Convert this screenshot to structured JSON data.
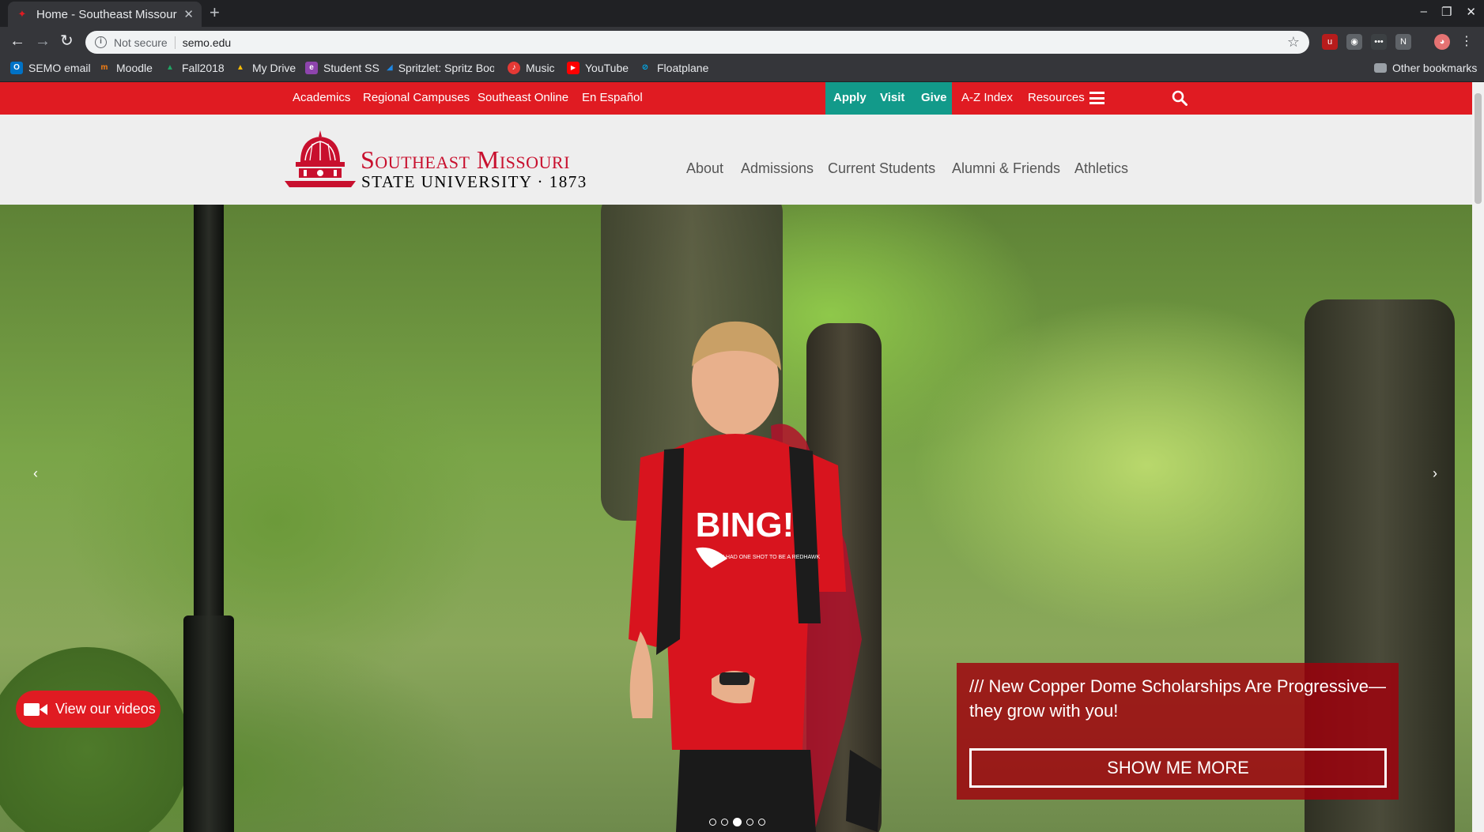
{
  "browser": {
    "tab_title": "Home - Southeast Missouri St",
    "new_tab": "+",
    "address": {
      "security_label": "Not secure",
      "url": "semo.edu"
    },
    "bookmarks": [
      {
        "label": "SEMO email",
        "icon": "outlook-icon",
        "color": "#0072c6"
      },
      {
        "label": "Moodle",
        "icon": "moodle-icon",
        "color": "#f98012"
      },
      {
        "label": "Fall2018",
        "icon": "drive-icon",
        "color": "#1fa463"
      },
      {
        "label": "My Drive",
        "icon": "drive-icon",
        "color": "#1fa463"
      },
      {
        "label": "Student SS",
        "icon": "e-icon",
        "color": "#8e44ad"
      },
      {
        "label": "Spritzlet: Spritz Boo",
        "icon": "spritz-icon",
        "color": "#1e88e5"
      },
      {
        "label": "Music",
        "icon": "music-icon",
        "color": "#e53935"
      },
      {
        "label": "YouTube",
        "icon": "youtube-icon",
        "color": "#ff0000"
      },
      {
        "label": "Floatplane",
        "icon": "floatplane-icon",
        "color": "#00aeef"
      }
    ],
    "other_bookmarks": "Other bookmarks"
  },
  "site": {
    "colors": {
      "brand_red": "#e01b22",
      "teal": "#129a8a"
    },
    "utility_nav": [
      "Academics",
      "Regional Campuses",
      "Southeast Online",
      "En Español"
    ],
    "cta_nav": [
      "Apply",
      "Visit",
      "Give"
    ],
    "right_nav": [
      "A-Z Index",
      "Resources"
    ],
    "logo": {
      "line1": "Southeast Missouri",
      "line2": "STATE UNIVERSITY · 1873"
    },
    "main_nav": [
      "About",
      "Admissions",
      "Current Students",
      "Alumni & Friends",
      "Athletics"
    ],
    "hero": {
      "shirt_text": "BING!",
      "shirt_small": "IF YOU HAD ONE SHOT TO BE A REDHAWK",
      "caption": "/// New Copper Dome Scholarships Are Progressive—they grow with you!",
      "button": "SHOW ME MORE",
      "prev": "‹",
      "next": "›",
      "slides": 5,
      "active_slide": 3
    },
    "video_button": "View our videos"
  }
}
